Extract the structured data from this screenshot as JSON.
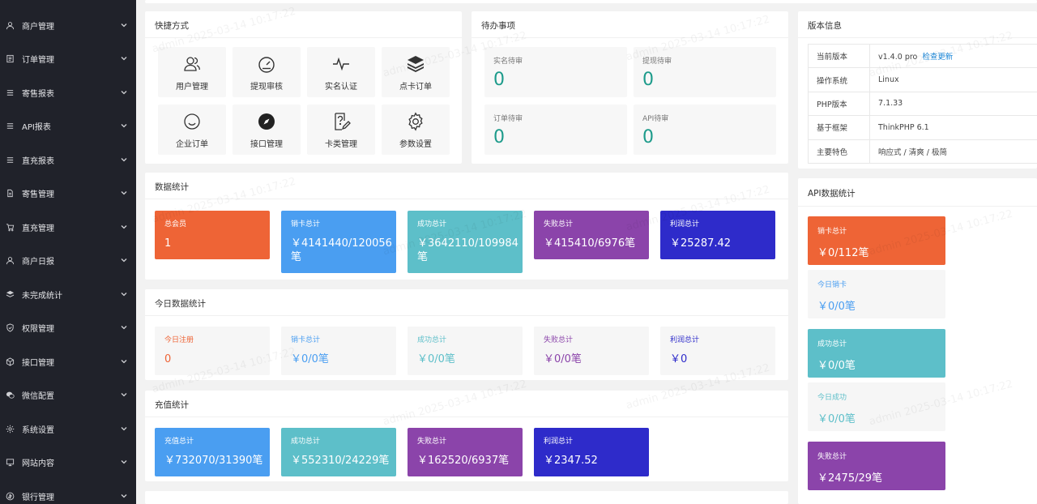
{
  "sidebar": {
    "items": [
      {
        "label": "商户管理",
        "icon": "user-icon"
      },
      {
        "label": "订单管理",
        "icon": "list-icon"
      },
      {
        "label": "寄售报表",
        "icon": "menu-icon"
      },
      {
        "label": "API报表",
        "icon": "menu-icon"
      },
      {
        "label": "直充报表",
        "icon": "menu-icon"
      },
      {
        "label": "寄售管理",
        "icon": "document-icon"
      },
      {
        "label": "直充管理",
        "icon": "cart-icon"
      },
      {
        "label": "商户日报",
        "icon": "user-icon"
      },
      {
        "label": "未完成统计",
        "icon": "layers-icon"
      },
      {
        "label": "权限管理",
        "icon": "shield-icon"
      },
      {
        "label": "接口管理",
        "icon": "box-icon"
      },
      {
        "label": "微信配置",
        "icon": "wechat-icon"
      },
      {
        "label": "系统设置",
        "icon": "gear-icon"
      },
      {
        "label": "网站内容",
        "icon": "monitor-icon"
      },
      {
        "label": "银行管理",
        "icon": "bank-icon"
      }
    ]
  },
  "quick": {
    "title": "快捷方式",
    "items": [
      {
        "label": "用户管理",
        "icon": "users-icon"
      },
      {
        "label": "提现审核",
        "icon": "gauge-icon"
      },
      {
        "label": "实名认证",
        "icon": "pulse-icon"
      },
      {
        "label": "点卡订单",
        "icon": "stack-icon"
      },
      {
        "label": "企业订单",
        "icon": "smile-icon"
      },
      {
        "label": "接口管理",
        "icon": "compass-icon"
      },
      {
        "label": "卡类管理",
        "icon": "help-edit-icon"
      },
      {
        "label": "参数设置",
        "icon": "gear-icon"
      }
    ]
  },
  "pending": {
    "title": "待办事项",
    "items": [
      {
        "label": "实名待审",
        "value": "0"
      },
      {
        "label": "提现待审",
        "value": "0"
      },
      {
        "label": "订单待审",
        "value": "0"
      },
      {
        "label": "API待审",
        "value": "0"
      }
    ]
  },
  "version": {
    "title": "版本信息",
    "rows": [
      {
        "key": "当前版本",
        "value": "v1.4.0 pro",
        "link": "检查更新"
      },
      {
        "key": "操作系统",
        "value": "Linux"
      },
      {
        "key": "PHP版本",
        "value": "7.1.33"
      },
      {
        "key": "基于框架",
        "value": "ThinkPHP 6.1"
      },
      {
        "key": "主要特色",
        "value": "响应式 / 清爽 / 极简"
      }
    ]
  },
  "stats": {
    "title": "数据统计",
    "tiles": [
      {
        "label": "总会员",
        "value": "1"
      },
      {
        "label": "销卡总计",
        "value": "￥4141440/120056笔"
      },
      {
        "label": "成功总计",
        "value": "￥3642110/109984笔"
      },
      {
        "label": "失败总计",
        "value": "￥415410/6976笔"
      },
      {
        "label": "利润总计",
        "value": "￥25287.42"
      }
    ]
  },
  "today": {
    "title": "今日数据统计",
    "tiles": [
      {
        "label": "今日注册",
        "value": "0"
      },
      {
        "label": "销卡总计",
        "value": "￥0/0笔"
      },
      {
        "label": "成功总计",
        "value": "￥0/0笔"
      },
      {
        "label": "失败总计",
        "value": "￥0/0笔"
      },
      {
        "label": "利润总计",
        "value": "￥0"
      }
    ]
  },
  "recharge": {
    "title": "充值统计",
    "tiles": [
      {
        "label": "充值总计",
        "value": "￥732070/31390笔"
      },
      {
        "label": "成功总计",
        "value": "￥552310/24229笔"
      },
      {
        "label": "失败总计",
        "value": "￥162520/6937笔"
      },
      {
        "label": "利润总计",
        "value": "￥2347.52"
      }
    ]
  },
  "api_stats": {
    "title": "API数据统计",
    "tiles": [
      {
        "label": "销卡总计",
        "value": "￥0/112笔"
      },
      {
        "label": "今日销卡",
        "value": "￥0/0笔"
      },
      {
        "label": "成功总计",
        "value": "￥0/0笔"
      },
      {
        "label": "今日成功",
        "value": "￥0/0笔"
      },
      {
        "label": "失败总计",
        "value": "￥2475/29笔"
      }
    ]
  },
  "watermark": "admin 2025-03-14 10:17:22",
  "colors": {
    "sidebar_bg": "#20222a",
    "orange": "#ee6436",
    "blue": "#4a9ef1",
    "cyan": "#5dbfc9",
    "purple": "#8b44aa",
    "indigo": "#2e2bca",
    "pending_value": "#1d9b8b",
    "link": "#1e88d8"
  }
}
